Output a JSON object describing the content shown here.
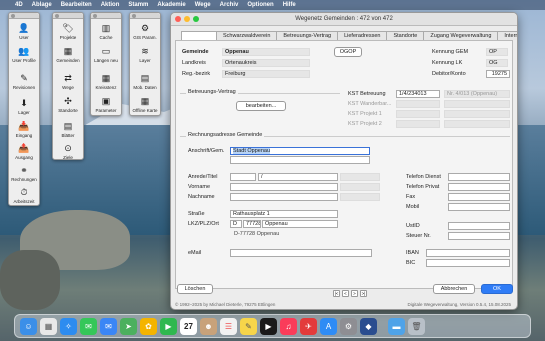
{
  "menubar": {
    "app": "4D",
    "items": [
      "Ablage",
      "Bearbeiten",
      "Aktion",
      "Stamm",
      "Akademie",
      "Wege",
      "Archiv",
      "Optionen",
      "Hilfe"
    ]
  },
  "palette1": {
    "items": [
      {
        "label": "User",
        "icon": "user-icon",
        "glyph": "👤"
      },
      {
        "label": "User Profile",
        "icon": "user-profile-icon",
        "glyph": "👥"
      },
      {
        "label": "Revisionen",
        "icon": "revision-icon",
        "glyph": "✎"
      },
      {
        "label": "Lager",
        "icon": "lager-icon",
        "glyph": "⬇"
      },
      {
        "label": "Eingang",
        "icon": "eingang-icon",
        "glyph": "📥"
      },
      {
        "label": "Ausgang",
        "icon": "ausgang-icon",
        "glyph": "📤"
      },
      {
        "label": "Rechnungen",
        "icon": "rechnungen-icon",
        "glyph": "⚭"
      },
      {
        "label": "Arbeitszeit",
        "icon": "clock-icon",
        "glyph": "⏱"
      }
    ]
  },
  "palette2": {
    "items": [
      {
        "label": "Projekte",
        "icon": "tag-icon",
        "glyph": "🏷"
      },
      {
        "label": "Gemeinden",
        "icon": "gemeinden-icon",
        "glyph": "▦"
      },
      {
        "label": "Wege",
        "icon": "wege-icon",
        "glyph": "⇄"
      },
      {
        "label": "Standorte",
        "icon": "standorte-icon",
        "glyph": "✣"
      },
      {
        "label": "Blätter",
        "icon": "blaetter-icon",
        "glyph": "▤"
      },
      {
        "label": "Ziele",
        "icon": "ziele-icon",
        "glyph": "⊙"
      }
    ]
  },
  "palette3": {
    "items": [
      {
        "label": "Cache",
        "icon": "cache-icon",
        "glyph": "▥"
      },
      {
        "label": "Längen neu",
        "icon": "laengen-icon",
        "glyph": "▭"
      },
      {
        "label": "Kreisstenz",
        "icon": "kreis-icon",
        "glyph": "▦"
      },
      {
        "label": "Parameter",
        "icon": "parameter-icon",
        "glyph": "▣"
      }
    ]
  },
  "palette4": {
    "items": [
      {
        "label": "GIS Param.",
        "icon": "gis-icon",
        "glyph": "⚙"
      },
      {
        "label": "Layer",
        "icon": "layer-icon",
        "glyph": "≋"
      },
      {
        "label": "Mob. Daten",
        "icon": "mob-daten-icon",
        "glyph": "▤"
      },
      {
        "label": "Offline Karte",
        "icon": "offline-karte-icon",
        "glyph": "▦"
      }
    ]
  },
  "window": {
    "title": "Wegenetz Gemeinden : 472 von 472",
    "tabs": [
      "",
      "Schwarzwaldverein",
      "Betreuungs-Vertrag",
      "Lieferadressen",
      "Standorte",
      "Zugang Wegeverwaltung",
      "Intern"
    ],
    "gemeinde_label": "Gemeinde",
    "gemeinde_value": "Oppenau",
    "ogop": "OGOP",
    "landkreis_label": "Landkreis",
    "landkreis_value": "Ortenaukreis",
    "regbezirk_label": "Reg.-bezirk",
    "regbezirk_value": "Freiburg",
    "kennung_gem_label": "Kennung GEM",
    "kennung_gem_value": "OP",
    "kennung_lk_label": "Kennung LK",
    "kennung_lk_value": "OG",
    "debitor_label": "Debitor/Konto",
    "debitor_value": "19275",
    "betreuungs_label": "Betreuungs-Vertrag",
    "bearbeiten": "bearbeiten...",
    "kst_betreuung_label": "KST Betreuung",
    "kst_betreuung_value": "1/4/234013",
    "kst_betreuung_nr": "Nr. 4/013 (Oppenau)",
    "kst_wanderbar_label": "KST Wanderbar...",
    "kst_projekt1_label": "KST Projekt 1",
    "kst_projekt2_label": "KST Projekt 2",
    "rechnungs_label": "Rechnungsadresse Gemeinde",
    "anschrift_label": "Anschrift/Gem.",
    "anschrift_value": "Stadt Oppenau",
    "anrede_label": "Anrede/Titel",
    "anrede_value": "/",
    "vorname_label": "Vorname",
    "nachname_label": "Nachname",
    "strasse_label": "Straße",
    "strasse_value": "Rathausplatz 1",
    "lkz_label": "LKZ/PLZ/Ort",
    "lkz_value": "D",
    "plz_value": "77728",
    "ort_value": "Oppenau",
    "address_line": "D-77728 Oppenau",
    "email_label": "eMail",
    "telefon_dienst_label": "Telefon Dienst",
    "telefon_privat_label": "Telefon Privat",
    "fax_label": "Fax",
    "mobil_label": "Mobil",
    "ustid_label": "UstID",
    "steuer_label": "Steuer Nr.",
    "iban_label": "IBAN",
    "bic_label": "BIC",
    "loeschen": "Löschen",
    "abbrechen": "Abbrechen",
    "ok": "OK",
    "nav": [
      "|<",
      "<",
      ">",
      ">|"
    ],
    "copyright": "© 1992–2025 by Michael Dieterle, 79275 Ettlingen",
    "version": "Digitale Wegeverwaltung, Version 0.5.4, 15.08.2025"
  },
  "dock": {
    "icons": [
      {
        "name": "finder-icon",
        "color": "#3b8fe8"
      },
      {
        "name": "launchpad-icon",
        "color": "#e8e8e8"
      },
      {
        "name": "safari-icon",
        "color": "#2d8cf0"
      },
      {
        "name": "messages-icon",
        "color": "#35c759"
      },
      {
        "name": "mail-icon",
        "color": "#3a86f5"
      },
      {
        "name": "maps-icon",
        "color": "#4cb05e"
      },
      {
        "name": "photos-icon",
        "color": "#f4b400"
      },
      {
        "name": "facetime-icon",
        "color": "#2fb84f"
      },
      {
        "name": "calendar-icon",
        "color": "#ffffff"
      },
      {
        "name": "contacts-icon",
        "color": "#c8a27a"
      },
      {
        "name": "reminders-icon",
        "color": "#f2f2f2"
      },
      {
        "name": "notes-icon",
        "color": "#f7d54a"
      },
      {
        "name": "tv-icon",
        "color": "#1a1a1a"
      },
      {
        "name": "music-icon",
        "color": "#fa3c5a"
      },
      {
        "name": "rocket-icon",
        "color": "#e33b3b"
      },
      {
        "name": "appstore-icon",
        "color": "#2e8cf5"
      },
      {
        "name": "settings-icon",
        "color": "#8e8e93"
      },
      {
        "name": "4d-icon",
        "color": "#2a4d8f"
      },
      {
        "name": "folder-icon",
        "color": "#4fa3e8"
      },
      {
        "name": "trash-icon",
        "color": "#b8c0c8"
      }
    ],
    "calendar_day": "27"
  }
}
